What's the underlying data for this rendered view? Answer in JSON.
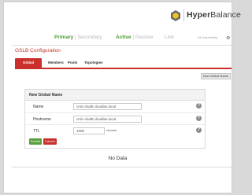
{
  "brand": {
    "name_bold": "Hyper",
    "name_rest": "Balance"
  },
  "topbar": {
    "primary": "Primary",
    "separator": "|",
    "secondary": "Secondary",
    "active": "Active",
    "passive": "Passive",
    "link": "Link",
    "user": "All Users/Help"
  },
  "section_title": "GSLB Configuration",
  "tabs": [
    {
      "label": "Global Name",
      "active": true
    },
    {
      "label": "Members",
      "active": false
    },
    {
      "label": "Pools",
      "active": false
    },
    {
      "label": "Topologies",
      "active": false
    }
  ],
  "new_button": "New Global Name",
  "form": {
    "title": "New Global Name",
    "name_label": "Name",
    "name_value": "cmic-cludtt.cloudlan.local",
    "hostname_label": "Hostname",
    "hostname_value": "cmic-cludtt.cloudlan.local",
    "ttl_label": "TTL",
    "ttl_value": "1000",
    "ttl_unit": "seconds",
    "help_glyph": "?",
    "submit": "Submit",
    "cancel": "Cancel"
  },
  "empty_state": "No Data",
  "colors": {
    "accent_red": "#c9302c",
    "accent_green": "#5a9f3a",
    "status_green": "#4e9a2e"
  },
  "icons": {
    "logo": "hyperbalance-logo-icon",
    "settings": "gear-icon",
    "help": "help-icon"
  }
}
